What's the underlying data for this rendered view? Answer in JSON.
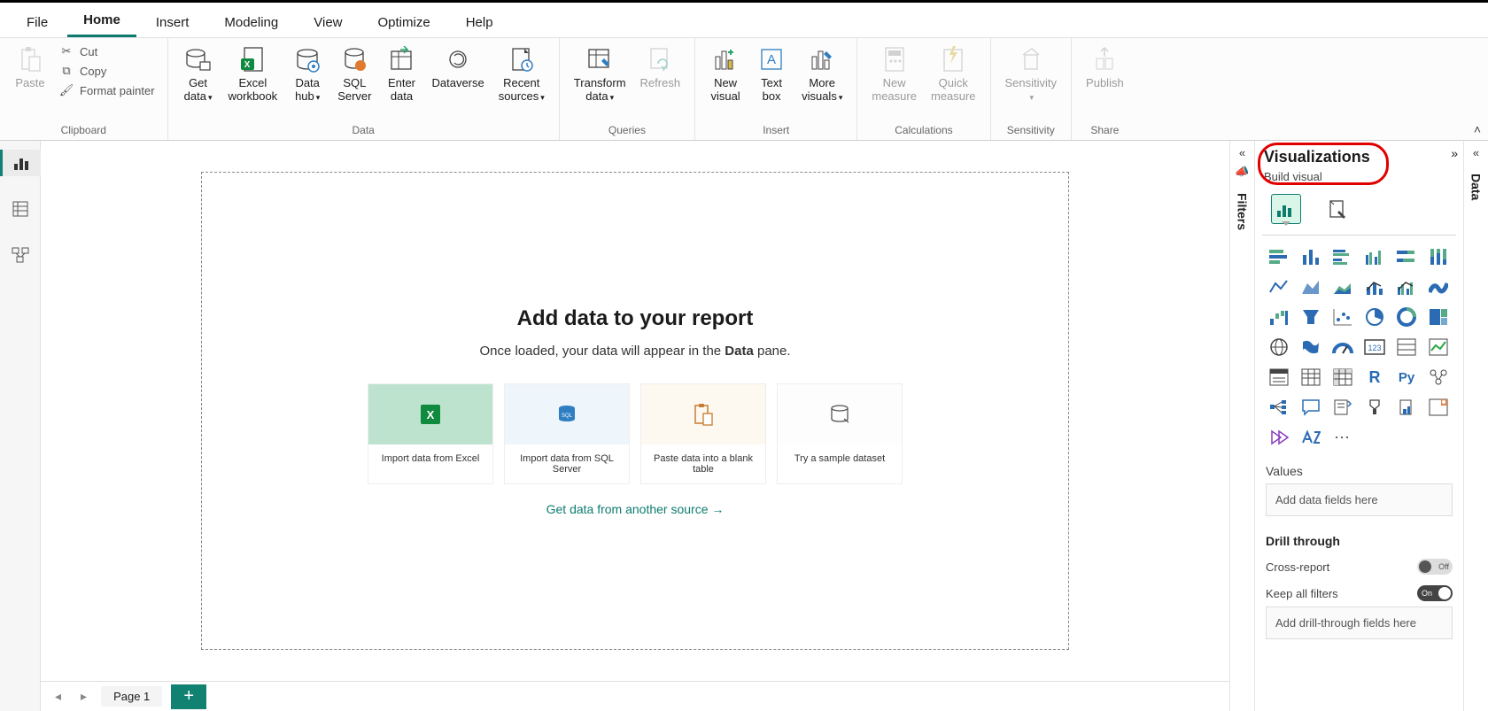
{
  "tabs": [
    "File",
    "Home",
    "Insert",
    "Modeling",
    "View",
    "Optimize",
    "Help"
  ],
  "active_tab": "Home",
  "clipboard": {
    "paste": "Paste",
    "cut": "Cut",
    "copy": "Copy",
    "format_painter": "Format painter",
    "group": "Clipboard"
  },
  "data": {
    "get": "Get\ndata",
    "excel": "Excel\nworkbook",
    "hub": "Data\nhub",
    "sql": "SQL\nServer",
    "enter": "Enter\ndata",
    "dataverse": "Dataverse",
    "recent": "Recent\nsources",
    "group": "Data"
  },
  "queries": {
    "transform": "Transform\ndata",
    "refresh": "Refresh",
    "group": "Queries"
  },
  "insert": {
    "newvis": "New\nvisual",
    "text": "Text\nbox",
    "more": "More\nvisuals",
    "group": "Insert"
  },
  "calc": {
    "newmeasure": "New\nmeasure",
    "quick": "Quick\nmeasure",
    "group": "Calculations"
  },
  "sens": {
    "label": "Sensitivity",
    "group": "Sensitivity"
  },
  "share": {
    "publish": "Publish",
    "group": "Share"
  },
  "canvas": {
    "title": "Add data to your report",
    "sub1": "Once loaded, your data will appear in the ",
    "sub2": "Data",
    "sub3": " pane.",
    "cards": [
      "Import data from Excel",
      "Import data from SQL Server",
      "Paste data into a blank table",
      "Try a sample dataset"
    ],
    "another": "Get data from another source →"
  },
  "pagetab": "Page 1",
  "filters_label": "Filters",
  "data_label": "Data",
  "viz": {
    "title": "Visualizations",
    "sub": "Build visual",
    "values": "Values",
    "values_ph": "Add data fields here",
    "drill": "Drill through",
    "cross": "Cross-report",
    "cross_state": "Off",
    "keep": "Keep all filters",
    "keep_state": "On",
    "drill_ph": "Add drill-through fields here"
  }
}
